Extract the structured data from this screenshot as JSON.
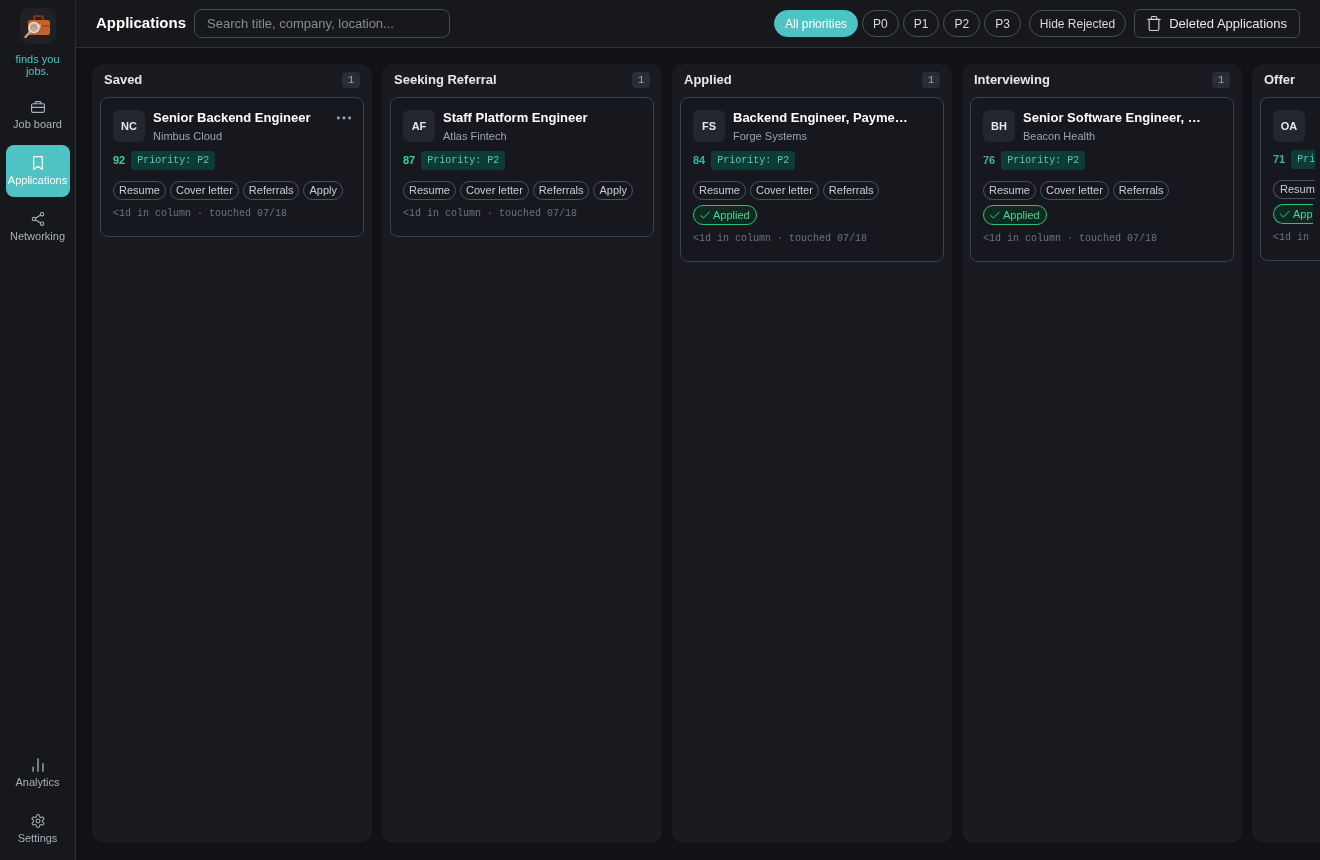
{
  "sidebar": {
    "tagline": "finds you jobs.",
    "nav": [
      {
        "label": "Job board",
        "selected": false
      },
      {
        "label": "Applications",
        "selected": true
      },
      {
        "label": "Networking",
        "selected": false
      }
    ],
    "bottom_nav": [
      {
        "label": "Analytics",
        "selected": false
      },
      {
        "label": "Settings",
        "selected": false
      }
    ]
  },
  "header": {
    "title": "Applications",
    "search": {
      "placeholder": "Search title, company, location..."
    },
    "priority_filters": [
      {
        "label": "All priorities",
        "selected": true
      },
      {
        "label": "P0",
        "selected": false
      },
      {
        "label": "P1",
        "selected": false
      },
      {
        "label": "P2",
        "selected": false
      },
      {
        "label": "P3",
        "selected": false
      }
    ],
    "hide_rejected": "Hide Rejected",
    "deleted_button": "Deleted Applications"
  },
  "columns": [
    {
      "title": "Saved",
      "count": "1",
      "cards": [
        {
          "initials": "NC",
          "title": "Senior Backend Engineer",
          "company": "Nimbus Cloud",
          "menu": true,
          "score": {
            "text": "92",
            "color": "#34d399"
          },
          "priority": "Priority: P2",
          "chips": [
            {
              "label": "Resume",
              "kind": "action"
            },
            {
              "label": "Cover letter",
              "kind": "action"
            },
            {
              "label": "Referrals",
              "kind": "action"
            },
            {
              "label": "Apply",
              "kind": "action"
            }
          ],
          "footer": "<1d in column · touched 07/18"
        }
      ]
    },
    {
      "title": "Seeking Referral",
      "count": "1",
      "cards": [
        {
          "initials": "AF",
          "title": "Staff Platform Engineer",
          "company": "Atlas Fintech",
          "menu": false,
          "score": {
            "text": "87",
            "color": "#34d399"
          },
          "priority": "Priority: P2",
          "chips": [
            {
              "label": "Resume",
              "kind": "action"
            },
            {
              "label": "Cover letter",
              "kind": "action"
            },
            {
              "label": "Referrals",
              "kind": "action"
            },
            {
              "label": "Apply",
              "kind": "action"
            }
          ],
          "footer": "<1d in column · touched 07/18"
        }
      ]
    },
    {
      "title": "Applied",
      "count": "1",
      "cards": [
        {
          "initials": "FS",
          "title": "Backend Engineer, Payme…",
          "company": "Forge Systems",
          "menu": false,
          "score": {
            "text": "84",
            "color": "#38b2ac"
          },
          "priority": "Priority: P2",
          "chips": [
            {
              "label": "Resume",
              "kind": "action"
            },
            {
              "label": "Cover letter",
              "kind": "action"
            },
            {
              "label": "Referrals",
              "kind": "action"
            },
            {
              "label": "Applied",
              "kind": "done"
            }
          ],
          "footer": "<1d in column · touched 07/18"
        }
      ]
    },
    {
      "title": "Interviewing",
      "count": "1",
      "cards": [
        {
          "initials": "BH",
          "title": "Senior Software Engineer, …",
          "company": "Beacon Health",
          "menu": false,
          "score": {
            "text": "76",
            "color": "#38b2ac"
          },
          "priority": "Priority: P2",
          "chips": [
            {
              "label": "Resume",
              "kind": "action"
            },
            {
              "label": "Cover letter",
              "kind": "action"
            },
            {
              "label": "Referrals",
              "kind": "action"
            },
            {
              "label": "Applied",
              "kind": "done"
            }
          ],
          "footer": "<1d in column · touched 07/18"
        }
      ]
    },
    {
      "title": "Offer",
      "cards": [
        {
          "initials": "OA",
          "menu": false,
          "score": {
            "text": "71",
            "color": "#38b2ac"
          },
          "priority": "Pri",
          "chips": [
            {
              "label": "Resum",
              "kind": "action"
            },
            {
              "label": "App",
              "kind": "done"
            }
          ],
          "footer": "<1d in"
        }
      ]
    }
  ]
}
